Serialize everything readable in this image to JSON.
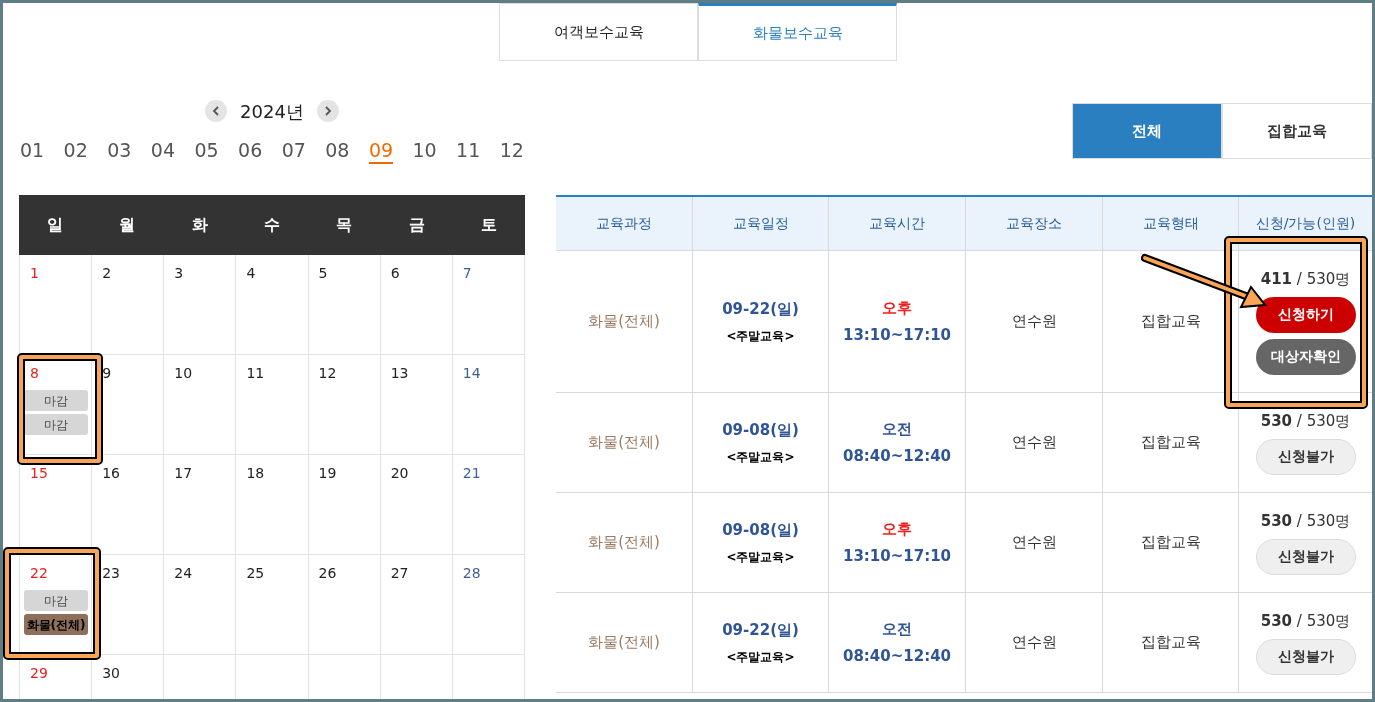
{
  "top_tabs": [
    {
      "label": "여객보수교육",
      "selected": false
    },
    {
      "label": "화물보수교육",
      "selected": true
    }
  ],
  "calendar": {
    "year": "2024년",
    "months": [
      {
        "label": "01",
        "selected": false
      },
      {
        "label": "02",
        "selected": false
      },
      {
        "label": "03",
        "selected": false
      },
      {
        "label": "04",
        "selected": false
      },
      {
        "label": "05",
        "selected": false
      },
      {
        "label": "06",
        "selected": false
      },
      {
        "label": "07",
        "selected": false
      },
      {
        "label": "08",
        "selected": false
      },
      {
        "label": "09",
        "selected": true
      },
      {
        "label": "10",
        "selected": false
      },
      {
        "label": "11",
        "selected": false
      },
      {
        "label": "12",
        "selected": false
      }
    ],
    "weekdays": [
      "일",
      "월",
      "화",
      "수",
      "목",
      "금",
      "토"
    ],
    "weeks": [
      [
        {
          "day": "1"
        },
        {
          "day": "2"
        },
        {
          "day": "3"
        },
        {
          "day": "4"
        },
        {
          "day": "5"
        },
        {
          "day": "6"
        },
        {
          "day": "7"
        }
      ],
      [
        {
          "day": "8",
          "events": [
            {
              "label": "마감",
              "kind": "closed"
            },
            {
              "label": "마감",
              "kind": "closed"
            }
          ]
        },
        {
          "day": "9"
        },
        {
          "day": "10"
        },
        {
          "day": "11"
        },
        {
          "day": "12"
        },
        {
          "day": "13"
        },
        {
          "day": "14"
        }
      ],
      [
        {
          "day": "15"
        },
        {
          "day": "16"
        },
        {
          "day": "17"
        },
        {
          "day": "18"
        },
        {
          "day": "19"
        },
        {
          "day": "20"
        },
        {
          "day": "21"
        }
      ],
      [
        {
          "day": "22",
          "events": [
            {
              "label": "마감",
              "kind": "closed"
            },
            {
              "label": "화물(전체)",
              "kind": "open"
            }
          ]
        },
        {
          "day": "23"
        },
        {
          "day": "24"
        },
        {
          "day": "25"
        },
        {
          "day": "26"
        },
        {
          "day": "27"
        },
        {
          "day": "28"
        }
      ],
      [
        {
          "day": "29"
        },
        {
          "day": "30"
        }
      ]
    ]
  },
  "filters": [
    {
      "label": "전체",
      "selected": true
    },
    {
      "label": "집합교육",
      "selected": false
    }
  ],
  "table": {
    "columns": [
      "교육과정",
      "교육일정",
      "교육시간",
      "교육장소",
      "교육형태",
      "신청/가능(인원)"
    ],
    "rows": [
      {
        "course": "화물(전체)",
        "date": "09-22(일)",
        "note": "<주말교육>",
        "period": {
          "text": "오후",
          "kind": "pm"
        },
        "time": "13:10~17:10",
        "place": "연수원",
        "type": "집합교육",
        "applied": "411",
        "capacity": "/ 530명",
        "buttons": [
          {
            "label": "신청하기",
            "kind": "apply"
          },
          {
            "label": "대상자확인",
            "kind": "check"
          }
        ]
      },
      {
        "course": "화물(전체)",
        "date": "09-08(일)",
        "note": "<주말교육>",
        "period": {
          "text": "오전",
          "kind": "am"
        },
        "time": "08:40~12:40",
        "place": "연수원",
        "type": "집합교육",
        "applied": "530",
        "capacity": "/ 530명",
        "buttons": [
          {
            "label": "신청불가",
            "kind": "unavailable"
          }
        ]
      },
      {
        "course": "화물(전체)",
        "date": "09-08(일)",
        "note": "<주말교육>",
        "period": {
          "text": "오후",
          "kind": "pm"
        },
        "time": "13:10~17:10",
        "place": "연수원",
        "type": "집합교육",
        "applied": "530",
        "capacity": "/ 530명",
        "buttons": [
          {
            "label": "신청불가",
            "kind": "unavailable"
          }
        ]
      },
      {
        "course": "화물(전체)",
        "date": "09-22(일)",
        "note": "<주말교육>",
        "period": {
          "text": "오전",
          "kind": "am"
        },
        "time": "08:40~12:40",
        "place": "연수원",
        "type": "집합교육",
        "applied": "530",
        "capacity": "/ 530명",
        "buttons": [
          {
            "label": "신청불가",
            "kind": "unavailable"
          }
        ]
      }
    ]
  }
}
